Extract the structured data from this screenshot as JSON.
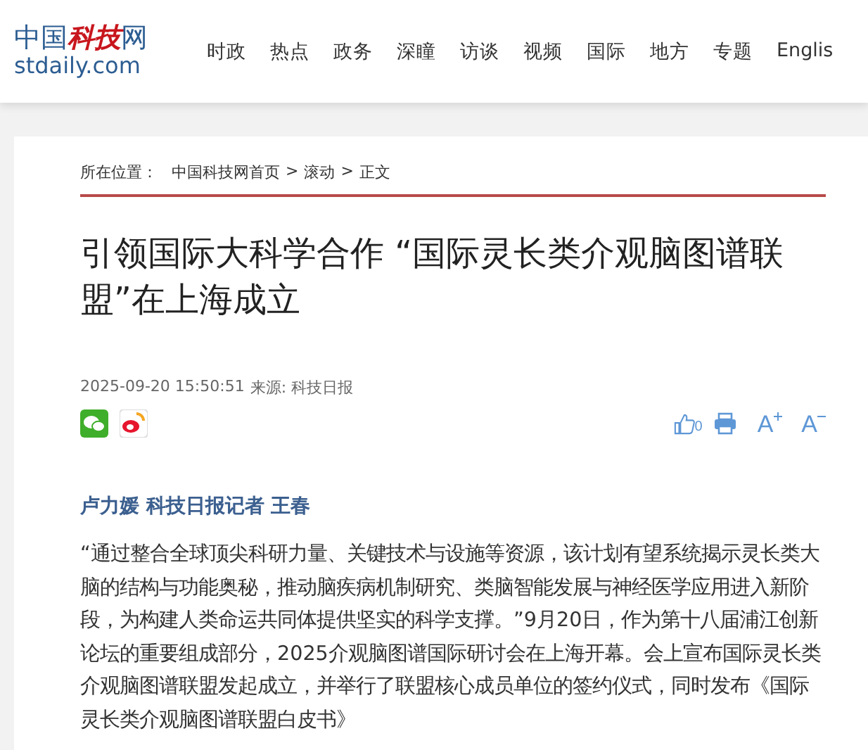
{
  "logo": {
    "parts": [
      {
        "text": "中国",
        "kind": "plain"
      },
      {
        "text": "科技",
        "kind": "brush"
      },
      {
        "text": "网",
        "kind": "plain"
      }
    ],
    "domain": "stdaily.com"
  },
  "nav": [
    "时政",
    "热点",
    "政务",
    "深瞳",
    "访谈",
    "视频",
    "国际",
    "地方",
    "专题",
    "Englis"
  ],
  "breadcrumb": {
    "label": "所在位置：",
    "items": [
      "中国科技网首页",
      "滚动",
      "正文"
    ],
    "separator": ">"
  },
  "title": "引领国际大科学合作 “国际灵长类介观脑图谱联盟”在上海成立",
  "meta": {
    "date": "2025-09-20 15:50:51",
    "source": "来源: 科技日报"
  },
  "share": [
    {
      "kind": "wechat"
    },
    {
      "kind": "weibo"
    }
  ],
  "tools": [
    {
      "kind": "like",
      "count": "0"
    },
    {
      "kind": "print"
    },
    {
      "kind": "larger",
      "label": "A"
    },
    {
      "kind": "smaller",
      "label": "A"
    }
  ],
  "byline": "卢力媛 科技日报记者 王春",
  "body": "“通过整合全球顶尖科研力量、关键技术与设施等资源，该计划有望系统揭示灵长类大脑的结构与功能奥秘，推动脑疾病机制研究、类脑智能发展与神经医学应用进入新阶段，为构建人类命运共同体提供坚实的科学支撑。”9月20日，作为第十八届浦江创新论坛的重要组成部分，2025介观脑图谱国际研讨会在上海开幕。会上宣布国际灵长类介观脑图谱联盟发起成立，并举行了联盟核心成员单位的签约仪式，同时发布《国际灵长类介观脑图谱联盟白皮书》"
}
